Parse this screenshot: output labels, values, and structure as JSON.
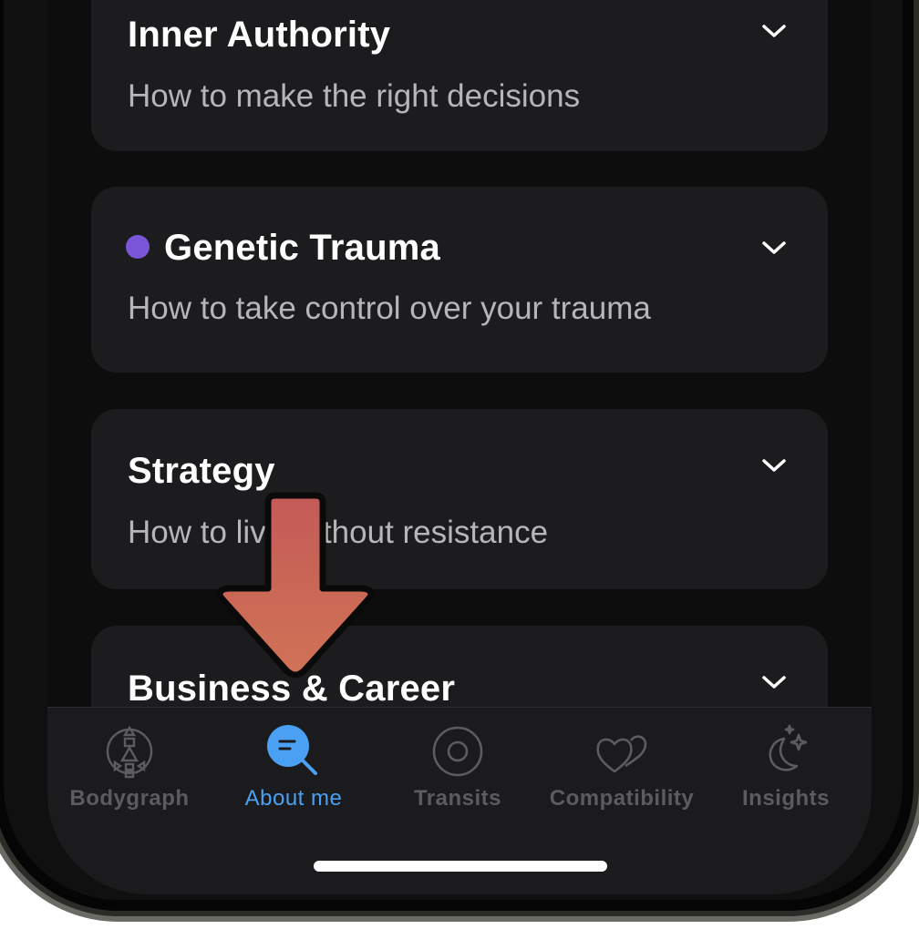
{
  "cards": [
    {
      "title": "Inner Authority",
      "subtitle": "How to make the right decisions",
      "dot": false
    },
    {
      "title": "Genetic Trauma",
      "subtitle": "How to take control over your trauma",
      "dot": true,
      "dot_color": "#7a55d6"
    },
    {
      "title": "Strategy",
      "subtitle": "How to live without resistance",
      "dot": false
    },
    {
      "title": "Business & Career",
      "subtitle": "",
      "dot": false
    }
  ],
  "tabs": [
    {
      "label": "Bodygraph",
      "icon": "bodygraph-icon",
      "active": false
    },
    {
      "label": "About me",
      "icon": "about-me-search-icon",
      "active": true
    },
    {
      "label": "Transits",
      "icon": "transits-target-icon",
      "active": false
    },
    {
      "label": "Compatibility",
      "icon": "hearts-icon",
      "active": false
    },
    {
      "label": "Insights",
      "icon": "moon-stars-icon",
      "active": false
    }
  ],
  "colors": {
    "accent": "#4aa0f2",
    "card_bg": "#1c1c1e",
    "arrow": "#c85c55"
  }
}
